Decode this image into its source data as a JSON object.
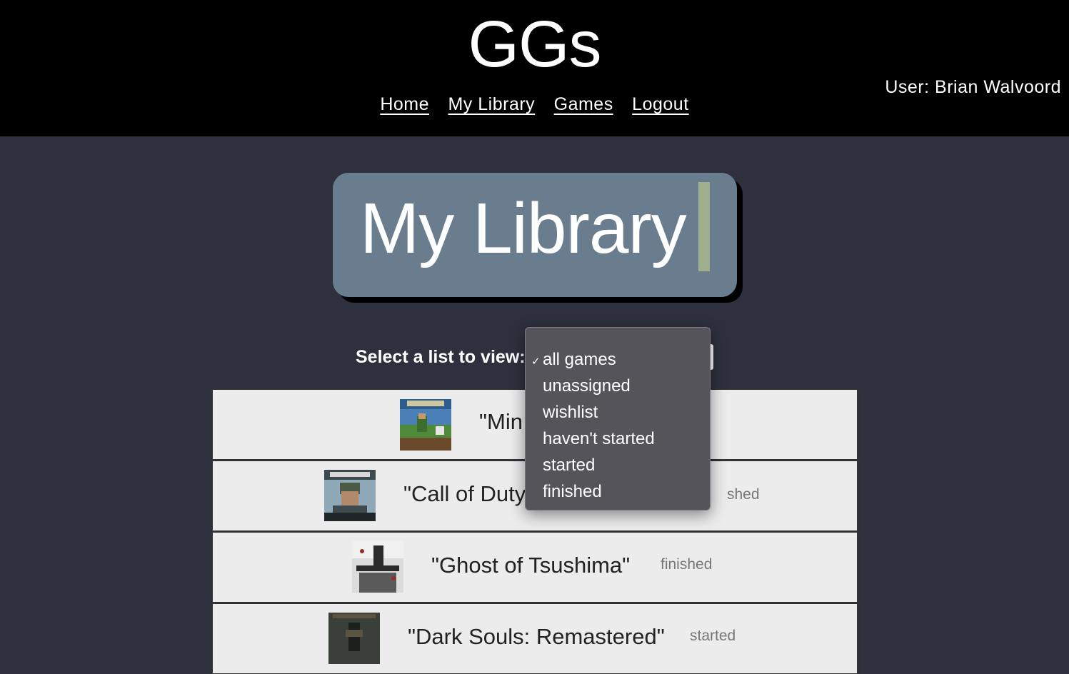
{
  "header": {
    "brand": "GGs",
    "nav": [
      "Home",
      "My Library",
      "Games",
      "Logout"
    ],
    "user": "User: Brian Walvoord"
  },
  "page_title": "My Library",
  "list_select": {
    "label": "Select a list to view:",
    "selected": "all games",
    "options": [
      "all games",
      "unassigned",
      "wishlist",
      "haven't started",
      "started",
      "finished"
    ]
  },
  "games": [
    {
      "title": "\"Min",
      "status": "",
      "cover_icon": "minecraft-cover",
      "colors": [
        "#4a7fb8",
        "#4f8a3a",
        "#6a4a2a"
      ]
    },
    {
      "title": "\"Call of Duty",
      "status": "shed",
      "cover_icon": "call-of-duty-cover",
      "colors": [
        "#8fa9b8",
        "#3d4a4e",
        "#1f2628"
      ]
    },
    {
      "title": "\"Ghost of Tsushima\"",
      "status": "finished",
      "cover_icon": "ghost-of-tsushima-cover",
      "colors": [
        "#dcdcdc",
        "#2a2a2a",
        "#9a2a2a"
      ]
    },
    {
      "title": "\"Dark Souls: Remastered\"",
      "status": "started",
      "cover_icon": "dark-souls-cover",
      "colors": [
        "#3a3f3a",
        "#5a5540",
        "#1c1f1c"
      ]
    }
  ],
  "colors": {
    "header_bg": "#000000",
    "page_bg": "#2e303d",
    "title_card": "#697d8f",
    "cursor_accent": "#9fae8d",
    "row_bg": "#ececec",
    "dropdown_bg": "#56545b"
  }
}
